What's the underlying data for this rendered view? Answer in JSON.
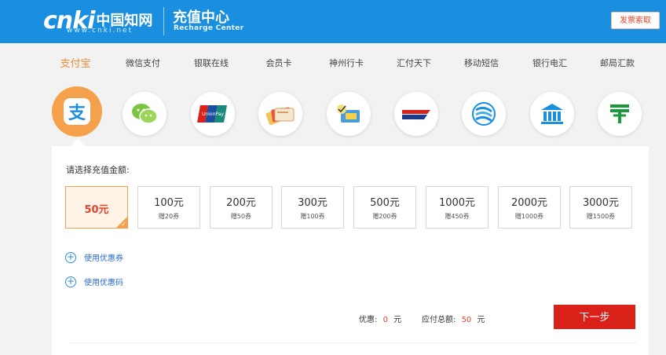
{
  "header": {
    "logo_word": "cnki",
    "logo_cn": "中国知网",
    "logo_url": "www.cnki.net",
    "title": "充值中心",
    "subtitle": "Recharge Center",
    "invoice_label": "发票索取"
  },
  "payment_methods": [
    {
      "label": "支付宝",
      "icon": "alipay-icon",
      "active": true
    },
    {
      "label": "微信支付",
      "icon": "wechat-icon",
      "active": false
    },
    {
      "label": "银联在线",
      "icon": "unionpay-icon",
      "active": false
    },
    {
      "label": "会员卡",
      "icon": "member-card-icon",
      "active": false
    },
    {
      "label": "神州行卡",
      "icon": "shenzhouxing-card-icon",
      "active": false
    },
    {
      "label": "汇付天下",
      "icon": "chinapnr-icon",
      "active": false
    },
    {
      "label": "移动短信",
      "icon": "china-mobile-icon",
      "active": false
    },
    {
      "label": "银行电汇",
      "icon": "bank-icon",
      "active": false
    },
    {
      "label": "邮局汇款",
      "icon": "post-office-icon",
      "active": false
    }
  ],
  "panel": {
    "prompt": "请选择充值金额:",
    "amounts": [
      {
        "value": "50元",
        "bonus": "",
        "selected": true
      },
      {
        "value": "100元",
        "bonus": "赠20券",
        "selected": false
      },
      {
        "value": "200元",
        "bonus": "赠50券",
        "selected": false
      },
      {
        "value": "300元",
        "bonus": "赠100券",
        "selected": false
      },
      {
        "value": "500元",
        "bonus": "赠200券",
        "selected": false
      },
      {
        "value": "1000元",
        "bonus": "赠450券",
        "selected": false
      },
      {
        "value": "2000元",
        "bonus": "赠1000券",
        "selected": false
      },
      {
        "value": "3000元",
        "bonus": "赠1500券",
        "selected": false
      }
    ],
    "coupon_label": "使用优惠券",
    "promo_label": "使用优惠码",
    "discount_label": "优惠:",
    "discount_value": "0",
    "discount_unit": "元",
    "total_label": "应付总额:",
    "total_value": "50",
    "total_unit": "元",
    "next_label": "下一步"
  },
  "colors": {
    "header_blue": "#1a8fe0",
    "accent_orange": "#f5a14b",
    "next_red": "#d9211a"
  }
}
